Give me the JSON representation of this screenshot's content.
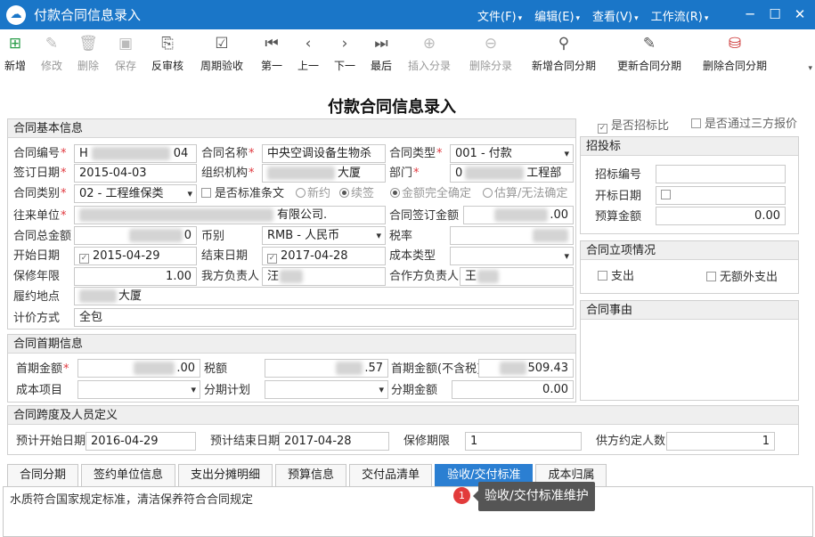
{
  "app": {
    "title": "付款合同信息录入"
  },
  "menu": [
    "文件(F)",
    "编辑(E)",
    "查看(V)",
    "工作流(R)"
  ],
  "toolbar": [
    {
      "label": "新增",
      "icon": "add-doc-icon",
      "enabled": true
    },
    {
      "label": "修改",
      "icon": "edit-icon",
      "enabled": false
    },
    {
      "label": "删除",
      "icon": "delete-icon",
      "enabled": false
    },
    {
      "label": "保存",
      "icon": "save-icon",
      "enabled": false
    },
    {
      "label": "反审核",
      "icon": "unaudit-icon",
      "enabled": true
    },
    {
      "label": "周期验收",
      "icon": "check-icon",
      "enabled": true
    },
    {
      "label": "第一",
      "icon": "first-icon",
      "enabled": true
    },
    {
      "label": "上一",
      "icon": "prev-icon",
      "enabled": true
    },
    {
      "label": "下一",
      "icon": "next-icon",
      "enabled": true
    },
    {
      "label": "最后",
      "icon": "last-icon",
      "enabled": true
    },
    {
      "label": "插入分录",
      "icon": "insert-row-icon",
      "enabled": false
    },
    {
      "label": "删除分录",
      "icon": "delete-row-icon",
      "enabled": false
    },
    {
      "label": "新增合同分期",
      "icon": "add-installment-icon",
      "enabled": true
    },
    {
      "label": "更新合同分期",
      "icon": "update-installment-icon",
      "enabled": true
    },
    {
      "label": "删除合同分期",
      "icon": "delete-installment-icon",
      "enabled": true
    }
  ],
  "form_title": "付款合同信息录入",
  "basic": {
    "header": "合同基本信息",
    "contract_no_label": "合同编号",
    "contract_no_prefix": "H",
    "contract_no_suffix": "04",
    "contract_name_label": "合同名称",
    "contract_name": "中央空调设备生物杀",
    "contract_type_label": "合同类型",
    "contract_type": "001 - 付款",
    "sign_date_label": "签订日期",
    "sign_date": "2015-04-03",
    "org_label": "组织机构",
    "org_suffix": "大厦",
    "dept_label": "部门",
    "dept_prefix": "0",
    "dept_suffix": "工程部",
    "category_label": "合同类别",
    "category": "02 - 工程维保类",
    "std_clause_label": "是否标准条文",
    "opt_new": "新约",
    "opt_renew": "续签",
    "opt_full": "金额完全确定",
    "opt_est": "估算/无法确定",
    "partner_label": "往来单位",
    "partner_suffix": "有限公司.",
    "sign_amount_label": "合同签订金额",
    "sign_amount_suffix": ".00",
    "total_amount_label": "合同总金额",
    "total_amount_suffix": "0",
    "currency_label": "币别",
    "currency": "RMB - 人民币",
    "tax_rate_label": "税率",
    "start_label": "开始日期",
    "start_date": "2015-04-29",
    "end_label": "结束日期",
    "end_date": "2017-04-28",
    "cost_type_label": "成本类型",
    "warranty_label": "保修年限",
    "warranty": "1.00",
    "our_owner_label": "我方负责人",
    "our_owner_partial": "汪",
    "partner_owner_label": "合作方负责人",
    "partner_owner_partial": "王",
    "location_label": "履约地点",
    "location_suffix": "大厦",
    "pricing_label": "计价方式",
    "pricing": "全包"
  },
  "first": {
    "header": "合同首期信息",
    "first_amount_label": "首期金额",
    "first_amount_suffix": ".00",
    "tax_label": "税额",
    "tax_suffix": ".57",
    "first_notax_label": "首期金额(不含税)",
    "first_notax_suffix": "509.43",
    "cost_item_label": "成本项目",
    "plan_label": "分期计划",
    "installment_amount_label": "分期金额",
    "installment_amount": "0.00"
  },
  "span": {
    "header": "合同跨度及人员定义",
    "est_start_label": "预计开始日期",
    "est_start": "2016-04-29",
    "est_end_label": "预计结束日期",
    "est_end": "2017-04-28",
    "warranty_label": "保修期限",
    "warranty": "1",
    "supplier_count_label": "供方约定人数",
    "supplier_count": "1"
  },
  "right": {
    "bid_compare_label": "是否招标比",
    "third_party_label": "是否通过三方报价",
    "bid_header": "招投标",
    "bid_no_label": "招标编号",
    "bid_date_label": "开标日期",
    "budget_label": "预算金额",
    "budget": "0.00",
    "project_header": "合同立项情况",
    "expense_label": "支出",
    "no_extra_label": "无额外支出",
    "reason_header": "合同事由"
  },
  "tabs": [
    "合同分期",
    "签约单位信息",
    "支出分摊明细",
    "预算信息",
    "交付品清单",
    "验收/交付标准",
    "成本归属"
  ],
  "active_tab_content": "水质符合国家规定标准，清洁保养符合合同规定",
  "tooltip": {
    "badge": "1",
    "text": "验收/交付标准维护"
  },
  "colors": {
    "titlebar": "#1a76c8",
    "active_tab": "#2b7fd2",
    "required": "#e0383e"
  }
}
